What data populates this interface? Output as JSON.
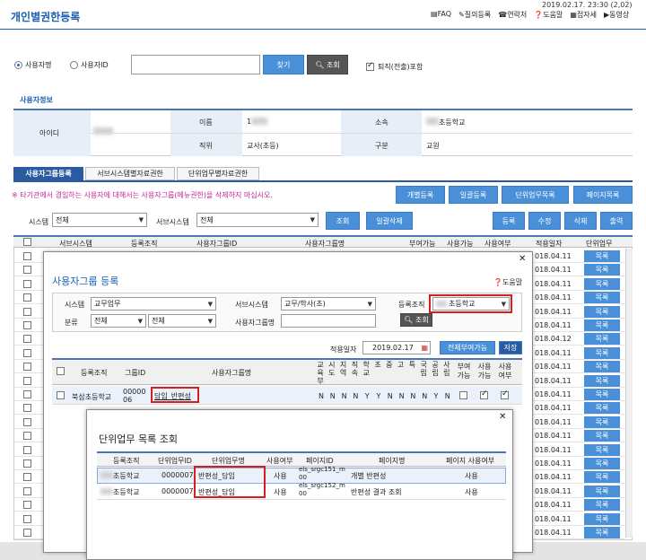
{
  "page": {
    "title": "개인별권한등록",
    "datetime": "2019.02.17. 23:30 (2,02)",
    "top_links": [
      "FAQ",
      "질의등록",
      "연락처",
      "도움말",
      "접자세",
      "동영상"
    ]
  },
  "search": {
    "radio_name": "사용자명",
    "radio_id": "사용자ID",
    "find_button": "찾기",
    "query_button": "조회",
    "retired_label": "퇴직(전출)포함"
  },
  "user_info": {
    "section_title": "사용자정보",
    "id_label": "아이디",
    "name_label": "이름",
    "name_value": "1",
    "dept_label": "소속",
    "dept_value": "초등학교",
    "position_label": "직위",
    "position_value": "교사(초등)",
    "type_label": "구분",
    "type_value": "교원"
  },
  "tabs": [
    "사용자그룹등록",
    "서브시스템별자료권한",
    "단위업무별자료권한"
  ],
  "warning": "※ 타기관에서 겸임하는 사용자에 대해서는 사용자그룹(메뉴권한)을 삭제하지 마십시오.",
  "action_buttons": [
    "개별등록",
    "일괄등록",
    "단위업무목록",
    "페이지목록"
  ],
  "filter": {
    "system_label": "시스템",
    "system_value": "전체",
    "subsystem_label": "서브시스템",
    "subsystem_value": "전체",
    "query_button": "조회",
    "bulk_delete": "일괄삭제",
    "register": "등록",
    "edit": "수정",
    "delete": "삭제",
    "print": "출력"
  },
  "main_table": {
    "headers": [
      "서브시스템",
      "등록조직",
      "사용자그룹ID",
      "사용자그룹명",
      "부여가능",
      "사용가능",
      "사용여부",
      "적용일자",
      "단위업무"
    ],
    "dates": [
      "018.04.11",
      "018.04.11",
      "018.04.11",
      "018.04.11",
      "018.04.11",
      "018.04.11",
      "018.04.12",
      "018.04.11",
      "018.04.11",
      "018.04.11",
      "018.04.11",
      "018.04.11",
      "018.04.11",
      "018.04.11",
      "018.04.11",
      "018.04.11",
      "018.04.11",
      "018.04.11",
      "018.04.11",
      "018.04.11",
      "018.04.11"
    ],
    "unit_label": "목록"
  },
  "modal1": {
    "title": "사용자그룹 등록",
    "help": "도움말",
    "system_label": "시스템",
    "system_value": "교무업무",
    "subsystem_label": "서브시스템",
    "subsystem_value": "교무/학사(초)",
    "org_label": "등록조직",
    "org_value": "초등학교",
    "class_label": "분류",
    "class_value1": "전체",
    "class_value2": "전체",
    "group_name_label": "사용자그룹명",
    "query_button": "조회",
    "apply_date_label": "적용일자",
    "apply_date_value": "2019.02.17",
    "grant_all": "전체부여가능",
    "save": "저장",
    "headers": [
      "등록조직",
      "그룹ID",
      "사용자그룹명"
    ],
    "vertical_headers": [
      "교육부",
      "시도",
      "지역",
      "직속",
      "학교",
      "초",
      "중",
      "고",
      "특",
      "국립",
      "공립",
      "사립"
    ],
    "grant_header": "부여가능",
    "use_possible_header": "사용가능",
    "use_header": "사용여부",
    "row": {
      "org": "북삼초등학교",
      "id": "0000006",
      "name": "담임_반편성",
      "flags": [
        "N",
        "N",
        "N",
        "N",
        "Y",
        "Y",
        "N",
        "N",
        "N",
        "N",
        "Y",
        "N"
      ]
    }
  },
  "modal2": {
    "title": "단위업무 목록 조회",
    "headers": [
      "등록조직",
      "단위업무ID",
      "단위업무명",
      "사용여부",
      "페이지ID",
      "페이지명",
      "페이지 사용여부"
    ],
    "rows": [
      {
        "org": "초등학교",
        "id": "0000007",
        "name": "반편성_담임",
        "use": "사용",
        "page_id": "els_srgc151_m 00",
        "page_name": "개별 반편성",
        "page_use": "사용"
      },
      {
        "org": "초등학교",
        "id": "0000007",
        "name": "반편성_담임",
        "use": "사용",
        "page_id": "els_srgc152_m 00",
        "page_name": "반편성 결과 조회",
        "page_use": "사용"
      }
    ]
  }
}
